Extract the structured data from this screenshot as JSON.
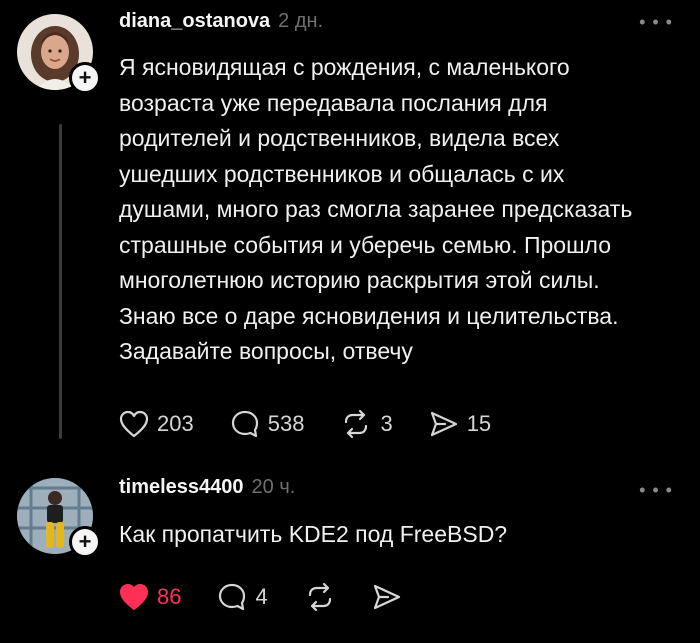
{
  "posts": [
    {
      "username": "diana_ostanova",
      "timestamp": "2 дн.",
      "body": "Я ясновидящая с рождения, с маленького\nвозраста уже передавала послания для\nродителей и родственников, видела всех\nушедших родственников и общалась с их\nдушами, много раз смогла заранее предсказать\nстрашные события и уберечь семью. Прошло\nмноголетнюю историю раскрытия этой силы.\nЗнаю все о даре ясновидения и целительства.\nЗадавайте вопросы, отвечу",
      "likes": "203",
      "comments": "538",
      "reposts": "3",
      "shares": "15",
      "liked": false
    },
    {
      "username": "timeless4400",
      "timestamp": "20 ч.",
      "body": "Как пропатчить KDE2 под FreeBSD?",
      "likes": "86",
      "comments": "4",
      "liked": true
    }
  ],
  "icons": {
    "more": "more-horizontal-icon",
    "follow": "plus-icon",
    "like": "heart-icon",
    "comment": "comment-bubble-icon",
    "repost": "repost-icon",
    "share": "send-icon"
  },
  "colors": {
    "background": "#000000",
    "like_active": "#ff2f55",
    "muted": "#6f6f6f"
  }
}
